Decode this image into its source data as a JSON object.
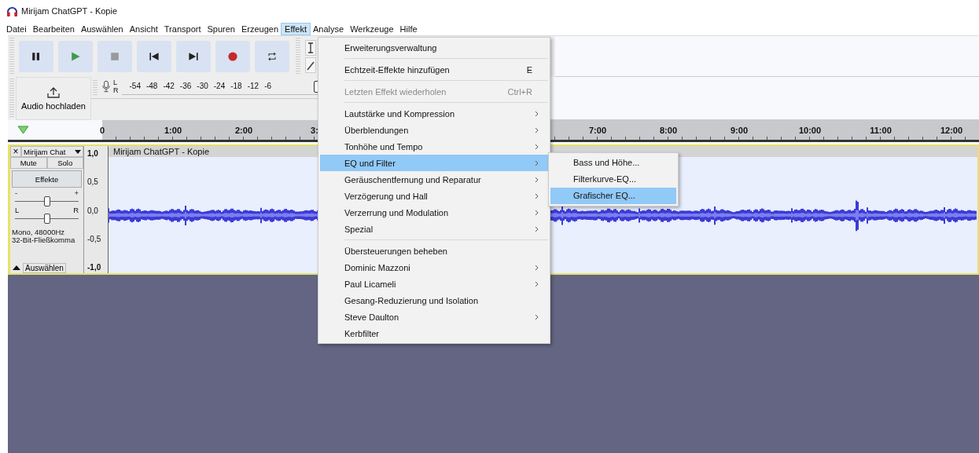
{
  "window": {
    "title": "Mirijam ChatGPT - Kopie"
  },
  "menubar": [
    {
      "label": "Datei",
      "selected": false
    },
    {
      "label": "Bearbeiten",
      "selected": false
    },
    {
      "label": "Auswählen",
      "selected": false
    },
    {
      "label": "Ansicht",
      "selected": false
    },
    {
      "label": "Transport",
      "selected": false
    },
    {
      "label": "Spuren",
      "selected": false
    },
    {
      "label": "Erzeugen",
      "selected": false
    },
    {
      "label": "Effekt",
      "selected": true
    },
    {
      "label": "Analyse",
      "selected": false
    },
    {
      "label": "Werkzeuge",
      "selected": false
    },
    {
      "label": "Hilfe",
      "selected": false
    }
  ],
  "upload_button": {
    "label": "Audio hochladen"
  },
  "meter": {
    "channels": [
      "L",
      "R"
    ],
    "ticks": [
      "-54",
      "-48",
      "-42",
      "-36",
      "-30",
      "-24",
      "-18",
      "-12",
      "-6"
    ],
    "level": 0.97
  },
  "ruler": {
    "left_labels": [
      "0",
      "1:00",
      "2:00",
      "3:"
    ],
    "right_labels": [
      "7:00",
      "8:00",
      "9:00",
      "10:00",
      "11:00",
      "12:00"
    ]
  },
  "track": {
    "close": "×",
    "name": "Mirijam Chat",
    "mute": "Mute",
    "solo": "Solo",
    "effects": "Effekte",
    "gain": {
      "minus": "-",
      "plus": "+",
      "level": 0.5
    },
    "pan": {
      "left": "L",
      "right": "R",
      "level": 0.5
    },
    "info": [
      "Mono, 48000Hz",
      "32-Bit-Fließkomma"
    ],
    "select": "Auswählen",
    "scale": [
      "1,0",
      "0,5",
      "0,0",
      "-0,5",
      "-1,0"
    ],
    "clip_title": "Mirijam ChatGPT - Kopie"
  },
  "menu": {
    "items": [
      {
        "label": "Erweiterungsverwaltung",
        "submenu": false,
        "disabled": false,
        "selected": false,
        "separator_after": true
      },
      {
        "label": "Echtzeit-Effekte hinzufügen",
        "shortcut": "E",
        "submenu": false,
        "disabled": false,
        "selected": false,
        "separator_after": true
      },
      {
        "label": "Letzten Effekt wiederholen",
        "shortcut": "Ctrl+R",
        "submenu": false,
        "disabled": true,
        "selected": false,
        "separator_after": true
      },
      {
        "label": "Lautstärke und Kompression",
        "submenu": true,
        "disabled": false,
        "selected": false,
        "separator_after": false
      },
      {
        "label": "Überblendungen",
        "submenu": true,
        "disabled": false,
        "selected": false,
        "separator_after": false
      },
      {
        "label": "Tonhöhe und Tempo",
        "submenu": true,
        "disabled": false,
        "selected": false,
        "separator_after": false
      },
      {
        "label": "EQ und Filter",
        "submenu": true,
        "disabled": false,
        "selected": true,
        "separator_after": false
      },
      {
        "label": "Geräuschentfernung und Reparatur",
        "submenu": true,
        "disabled": false,
        "selected": false,
        "separator_after": false
      },
      {
        "label": "Verzögerung und Hall",
        "submenu": true,
        "disabled": false,
        "selected": false,
        "separator_after": false
      },
      {
        "label": "Verzerrung und Modulation",
        "submenu": true,
        "disabled": false,
        "selected": false,
        "separator_after": false
      },
      {
        "label": "Spezial",
        "submenu": true,
        "disabled": false,
        "selected": false,
        "separator_after": true
      },
      {
        "label": "Übersteuerungen beheben",
        "submenu": false,
        "disabled": false,
        "selected": false,
        "separator_after": false
      },
      {
        "label": "Dominic Mazzoni",
        "submenu": true,
        "disabled": false,
        "selected": false,
        "separator_after": false
      },
      {
        "label": "Paul Licameli",
        "submenu": true,
        "disabled": false,
        "selected": false,
        "separator_after": false
      },
      {
        "label": "Gesang-Reduzierung und Isolation",
        "submenu": false,
        "disabled": false,
        "selected": false,
        "separator_after": false
      },
      {
        "label": "Steve Daulton",
        "submenu": true,
        "disabled": false,
        "selected": false,
        "separator_after": false
      },
      {
        "label": "Kerbfilter",
        "submenu": false,
        "disabled": false,
        "selected": false,
        "separator_after": false
      }
    ]
  },
  "submenu": {
    "items": [
      {
        "label": "Bass und Höhe...",
        "selected": false
      },
      {
        "label": "Filterkurve-EQ...",
        "selected": false
      },
      {
        "label": "Grafischer EQ...",
        "selected": true
      }
    ]
  }
}
